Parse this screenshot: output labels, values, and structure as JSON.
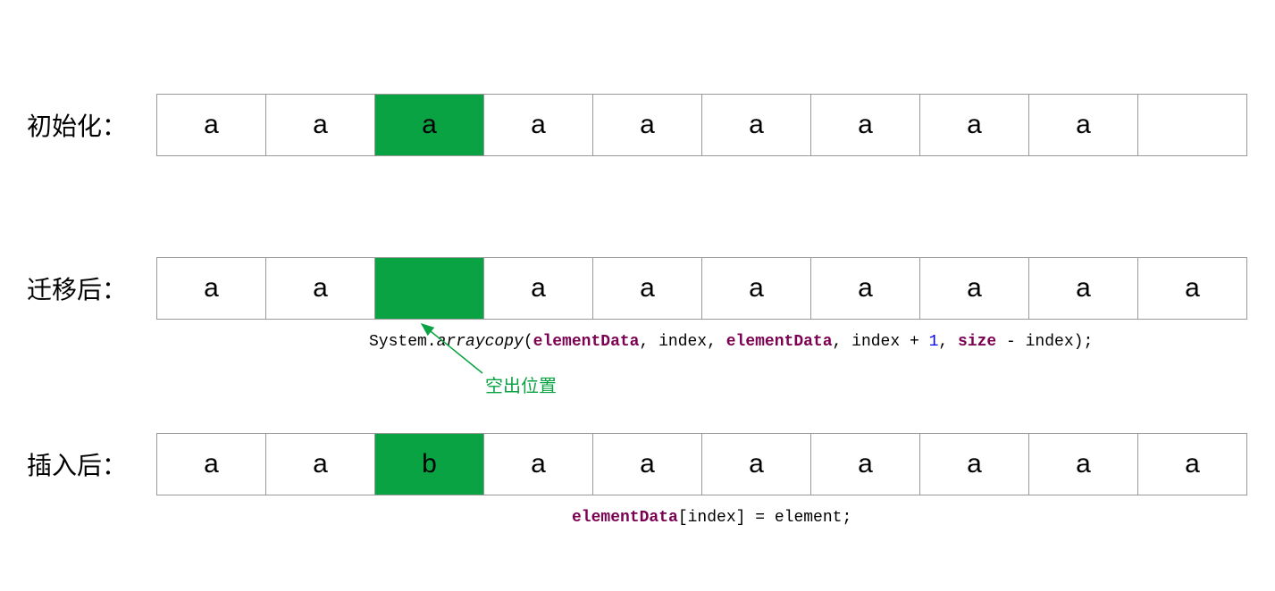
{
  "rows": [
    {
      "label": "初始化：",
      "cells": [
        "a",
        "a",
        "a",
        "a",
        "a",
        "a",
        "a",
        "a",
        "a",
        ""
      ],
      "highlight_index": 2
    },
    {
      "label": "迁移后：",
      "cells": [
        "a",
        "a",
        "",
        "a",
        "a",
        "a",
        "a",
        "a",
        "a",
        "a"
      ],
      "highlight_index": 2
    },
    {
      "label": "插入后：",
      "cells": [
        "a",
        "a",
        "b",
        "a",
        "a",
        "a",
        "a",
        "a",
        "a",
        "a"
      ],
      "highlight_index": 2
    }
  ],
  "code1": {
    "prefix": "System.",
    "method": "arraycopy",
    "paren_open": "(",
    "arg1": "elementData",
    "comma1": ", ",
    "arg2": "index",
    "comma2": ", ",
    "arg3": "elementData",
    "comma3": ", ",
    "arg4a": "index + ",
    "arg4b": "1",
    "comma4": ", ",
    "arg5a": "size",
    "arg5b": " - index)",
    "semi": ";"
  },
  "annotation": "空出位置",
  "code2": {
    "arg1": "elementData",
    "bracket_idx": "[index] = element;"
  }
}
